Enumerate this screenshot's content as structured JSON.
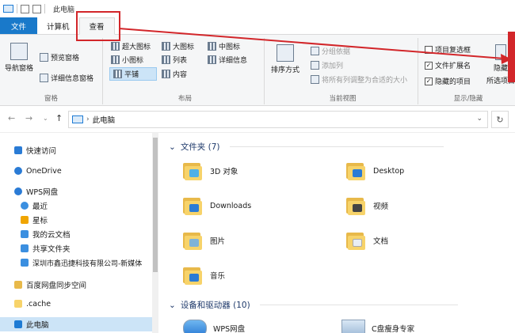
{
  "window": {
    "title": "此电脑"
  },
  "tabs": [
    "文件",
    "计算机",
    "查看"
  ],
  "ribbon": {
    "pane_group": {
      "label": "窗格",
      "nav_pane": "导航窗格",
      "preview_pane": "预览窗格",
      "details_pane": "详细信息窗格"
    },
    "layout_group": {
      "label": "布局",
      "items": [
        "超大图标",
        "大图标",
        "中图标",
        "小图标",
        "列表",
        "详细信息",
        "平铺",
        "内容"
      ]
    },
    "current_view_group": {
      "label": "当前视图",
      "sort_by": "排序方式",
      "group_by": "分组依据",
      "add_columns": "添加列",
      "size_all_columns": "将所有列调整为合适的大小"
    },
    "show_hide_group": {
      "label": "显示/隐藏",
      "item_checkboxes": {
        "label": "项目复选框",
        "checked": false
      },
      "file_extensions": {
        "label": "文件扩展名",
        "checked": true
      },
      "hidden_items": {
        "label": "隐藏的项目",
        "checked": true
      },
      "hide_btn": "隐藏",
      "hide_btn_sub": "所选项目"
    }
  },
  "address": {
    "crumb": "此电脑"
  },
  "nav_pane": {
    "items": [
      {
        "label": "快速访问",
        "color": "#2a7bd5"
      },
      {
        "label": "OneDrive",
        "color": "#2a7bd5"
      },
      {
        "label": "WPS网盘",
        "color": "#2a7bd5"
      },
      {
        "label": "最近",
        "color": "#3b8fe0"
      },
      {
        "label": "星标",
        "color": "#f0a500"
      },
      {
        "label": "我的云文档",
        "color": "#3b8fe0"
      },
      {
        "label": "共享文件夹",
        "color": "#3b8fe0"
      },
      {
        "label": "深圳市鑫迅捷科技有限公司-新媒体",
        "color": "#3b8fe0"
      },
      {
        "label": "百度网盘同步空间",
        "color": "#e8b94a"
      },
      {
        "label": ".cache",
        "color": "#f7d36a"
      },
      {
        "label": "此电脑",
        "color": "#1e7bd4"
      }
    ]
  },
  "content": {
    "folders_header": "文件夹 (7)",
    "folders": [
      {
        "name": "3D 对象",
        "badge": "#4fb0e8"
      },
      {
        "name": "Desktop",
        "badge": "#2a7bd5"
      },
      {
        "name": "Downloads",
        "badge": "#2a7bd5"
      },
      {
        "name": "视频",
        "badge": "#444444"
      },
      {
        "name": "图片",
        "badge": "#7fb3d9"
      },
      {
        "name": "文档",
        "badge": "#e9eef3"
      },
      {
        "name": "音乐",
        "badge": "#2a7bd5"
      }
    ],
    "drives_header": "设备和驱动器 (10)",
    "drives": [
      "WPS网盘",
      "C盘瘦身专家"
    ]
  }
}
